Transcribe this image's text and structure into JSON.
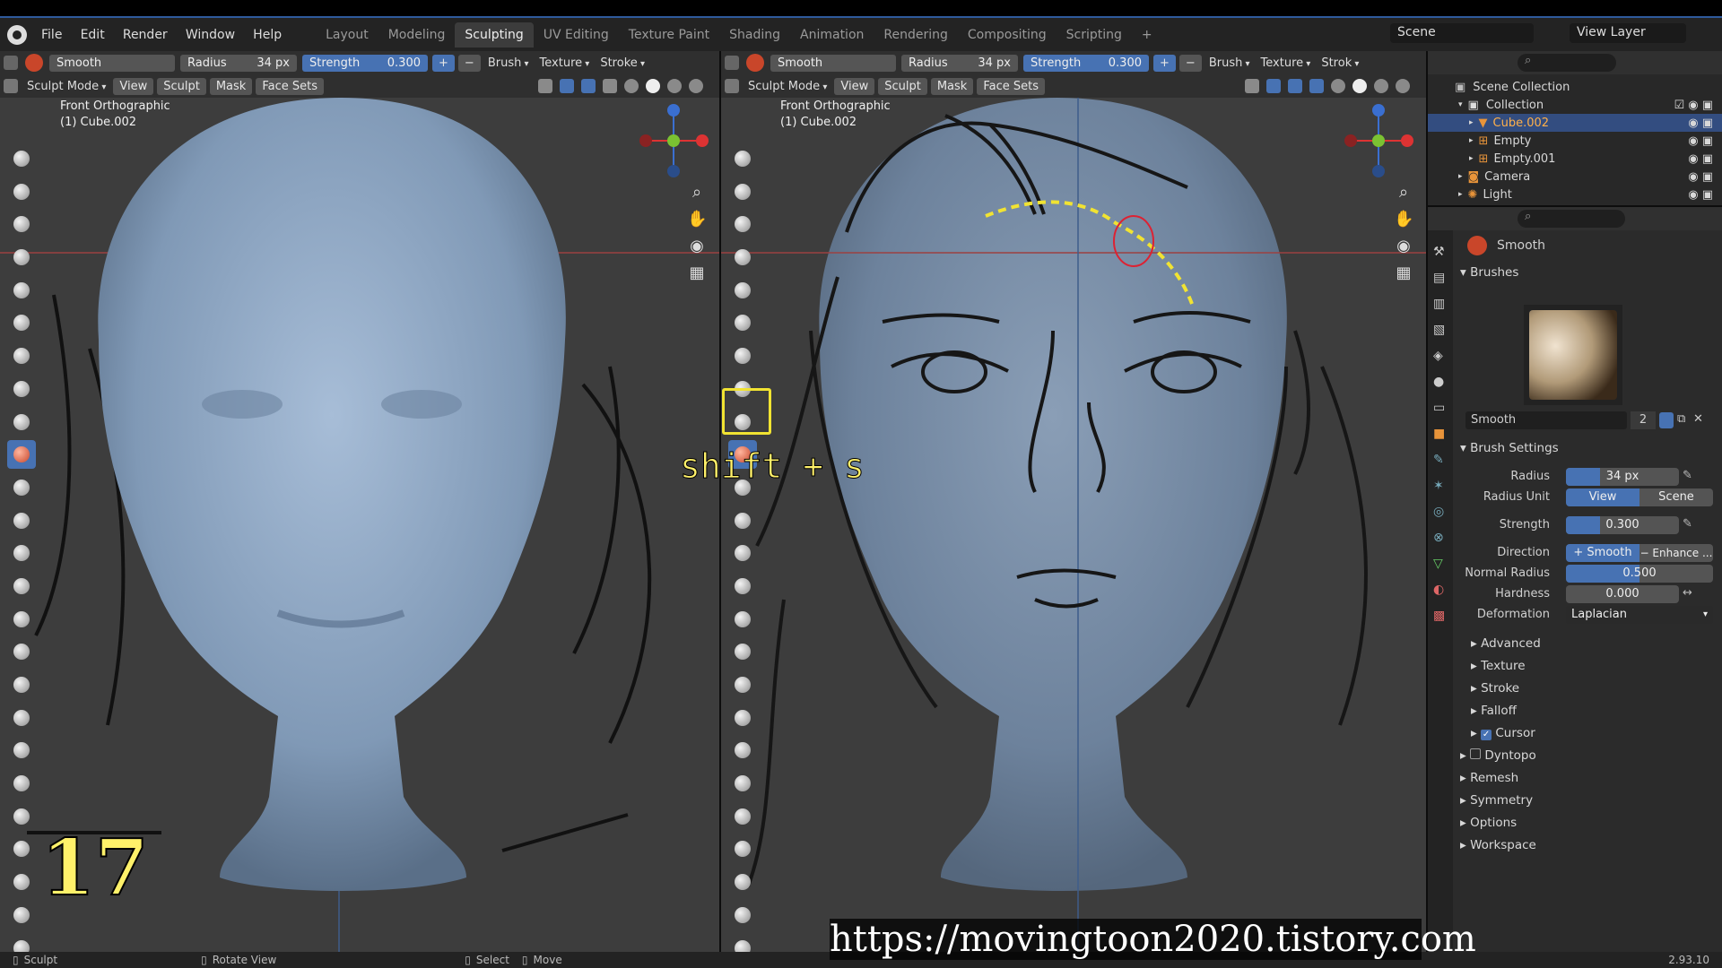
{
  "top_menu": [
    "File",
    "Edit",
    "Render",
    "Window",
    "Help"
  ],
  "workspace_tabs": [
    "Layout",
    "Modeling",
    "Sculpting",
    "UV Editing",
    "Texture Paint",
    "Shading",
    "Animation",
    "Rendering",
    "Compositing",
    "Scripting"
  ],
  "active_tab": "Sculpting",
  "scene_name": "Scene",
  "view_layer": "View Layer",
  "viewport_left": {
    "brush": "Smooth",
    "radius_label": "Radius",
    "radius_value": "34 px",
    "strength_label": "Strength",
    "strength_value": "0.300",
    "menus": [
      "Brush",
      "Texture",
      "Stroke"
    ],
    "mode": "Sculpt Mode",
    "header_menus": [
      "View",
      "Sculpt",
      "Mask",
      "Face Sets"
    ],
    "overlay_title": "Front Orthographic",
    "overlay_object": "(1) Cube.002"
  },
  "viewport_right": {
    "brush": "Smooth",
    "radius_label": "Radius",
    "radius_value": "34 px",
    "strength_label": "Strength",
    "strength_value": "0.300",
    "menus": [
      "Brush",
      "Texture",
      "Strok"
    ],
    "mode": "Sculpt Mode",
    "header_menus": [
      "View",
      "Sculpt",
      "Mask",
      "Face Sets"
    ],
    "overlay_title": "Front Orthographic",
    "overlay_object": "(1) Cube.002"
  },
  "outliner": {
    "root": "Scene Collection",
    "items": [
      {
        "name": "Collection",
        "indent": 1,
        "selected": false
      },
      {
        "name": "Cube.002",
        "indent": 2,
        "selected": true
      },
      {
        "name": "Empty",
        "indent": 2,
        "selected": false
      },
      {
        "name": "Empty.001",
        "indent": 2,
        "selected": false
      },
      {
        "name": "Camera",
        "indent": 1,
        "selected": false
      },
      {
        "name": "Light",
        "indent": 1,
        "selected": false
      }
    ]
  },
  "properties": {
    "tool_name": "Smooth",
    "brushes_label": "Brushes",
    "brush_name": "Smooth",
    "brush_users": "2",
    "brush_settings_label": "Brush Settings",
    "radius_label": "Radius",
    "radius_value": "34 px",
    "radius_fill": 0.3,
    "radius_unit_label": "Radius Unit",
    "radius_unit_options": [
      "View",
      "Scene"
    ],
    "strength_label": "Strength",
    "strength_value": "0.300",
    "strength_fill": 0.3,
    "direction_label": "Direction",
    "direction_options": [
      "+ Smooth",
      "− Enhance ..."
    ],
    "normal_radius_label": "Normal Radius",
    "normal_radius_value": "0.500",
    "normal_radius_fill": 0.5,
    "hardness_label": "Hardness",
    "hardness_value": "0.000",
    "deformation_label": "Deformation",
    "deformation_value": "Laplacian",
    "subpanels": [
      "Advanced",
      "Texture",
      "Stroke",
      "Falloff",
      "Cursor"
    ],
    "panels": [
      "Dyntopo",
      "Remesh",
      "Symmetry",
      "Options",
      "Workspace"
    ]
  },
  "status_bar": {
    "items": [
      "Sculpt",
      "Rotate View",
      "Select",
      "Move"
    ],
    "version": "2.93.10"
  },
  "annotations": {
    "step_number": "17",
    "shortcut": "shift + s",
    "url": "https://movingtoon2020.tistory.com"
  }
}
